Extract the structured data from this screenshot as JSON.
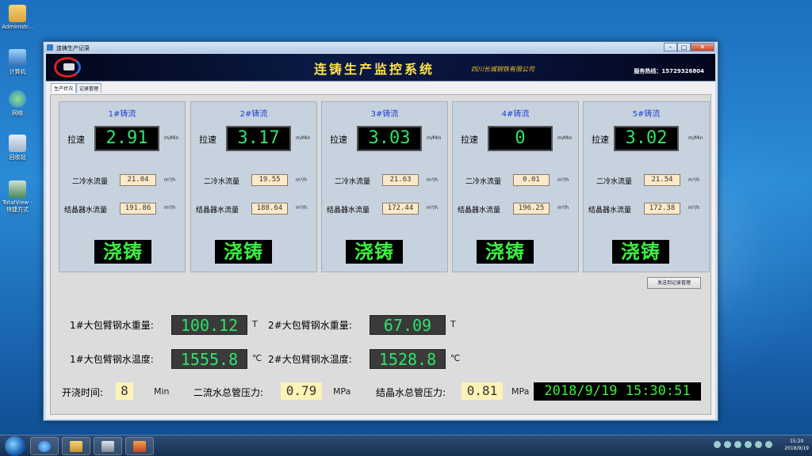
{
  "desktop": {
    "icons": [
      {
        "label": "Administr..."
      },
      {
        "label": "计算机"
      },
      {
        "label": "网络"
      },
      {
        "label": "回收站"
      },
      {
        "label": "TotalView - 快捷方式"
      }
    ]
  },
  "window": {
    "title": "连铸生产记录",
    "buttons": {
      "min": "–",
      "max": "□",
      "close": "✕"
    }
  },
  "header": {
    "title": "连铸生产监控系统",
    "company": "四川长城钢铁有限公司",
    "hotline": "服务热线：15729326804"
  },
  "tabs": [
    {
      "label": "生产状况"
    },
    {
      "label": "记录管理"
    }
  ],
  "strands": [
    {
      "title": "1#铸流",
      "speed_label": "拉速",
      "speed": "2.91",
      "speed_unit": "m/Min",
      "cool_label": "二冷水流量",
      "cool": "21.04",
      "cool_unit": "m³/h",
      "mold_label": "结晶器水流量",
      "mold": "191.86",
      "mold_unit": "m³/h",
      "status": "浇铸"
    },
    {
      "title": "2#铸流",
      "speed_label": "拉速",
      "speed": "3.17",
      "speed_unit": "m/Min",
      "cool_label": "二冷水流量",
      "cool": "19.55",
      "cool_unit": "m³/h",
      "mold_label": "结晶器水流量",
      "mold": "188.64",
      "mold_unit": "m³/h",
      "status": "浇铸"
    },
    {
      "title": "3#铸流",
      "speed_label": "拉速",
      "speed": "3.03",
      "speed_unit": "m/Min",
      "cool_label": "二冷水流量",
      "cool": "21.63",
      "cool_unit": "m³/h",
      "mold_label": "结晶器水流量",
      "mold": "172.44",
      "mold_unit": "m³/h",
      "status": "浇铸"
    },
    {
      "title": "4#铸流",
      "speed_label": "拉速",
      "speed": "0",
      "speed_unit": "m/Min",
      "cool_label": "二冷水流量",
      "cool": "0.01",
      "cool_unit": "m³/h",
      "mold_label": "结晶器水流量",
      "mold": "196.25",
      "mold_unit": "m³/h",
      "status": "浇铸"
    },
    {
      "title": "5#铸流",
      "speed_label": "拉速",
      "speed": "3.02",
      "speed_unit": "m/Min",
      "cool_label": "二冷水流量",
      "cool": "21.54",
      "cool_unit": "m³/h",
      "mold_label": "结晶器水流量",
      "mold": "172.38",
      "mold_unit": "m³/h",
      "status": "浇铸"
    }
  ],
  "send_button": "发送到记录管理",
  "ladle": {
    "w1_label": "1#大包臂钢水重量:",
    "w1": "100.12",
    "w1_unit": "T",
    "w2_label": "2#大包臂钢水重量:",
    "w2": "67.09",
    "w2_unit": "T",
    "t1_label": "1#大包臂钢水温度:",
    "t1": "1555.8",
    "t1_unit": "℃",
    "t2_label": "2#大包臂钢水温度:",
    "t2": "1528.8",
    "t2_unit": "℃"
  },
  "bottom": {
    "time_label": "开浇时间:",
    "time": "8",
    "time_unit": "Min",
    "cool_pressure_label": "二流水总管压力:",
    "cool_pressure": "0.79",
    "cool_pressure_unit": "MPa",
    "mold_pressure_label": "结晶水总管压力:",
    "mold_pressure": "0.81",
    "mold_pressure_unit": "MPa",
    "datetime": "2018/9/19 15:30:51"
  },
  "taskbar": {
    "clock_time": "15:20",
    "clock_date": "2018/9/19"
  }
}
